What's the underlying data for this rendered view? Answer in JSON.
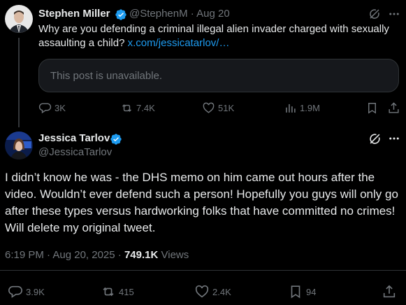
{
  "tweet1": {
    "name": "Stephen Miller",
    "handle": "@StephenM",
    "dot": "·",
    "date": "Aug 20",
    "text": "Why are you defending a criminal illegal alien invader charged with sexually assaulting a child?",
    "link": "x.com/jessicatarlov/…",
    "quote_unavailable": "This post is unavailable.",
    "actions": {
      "replies": "3K",
      "reposts": "7.4K",
      "likes": "51K",
      "views": "1.9M"
    }
  },
  "tweet2": {
    "name": "Jessica Tarlov",
    "handle": "@JessicaTarlov",
    "text": "I didn’t know he was - the DHS memo on him came out hours after the video. Wouldn’t ever defend such a person! Hopefully you guys will only go after these types versus hardworking folks that have committed no crimes! Will delete my original tweet.",
    "time": "6:19 PM · Aug 20, 2025 ·",
    "views_count": "749.1K",
    "views_label": "Views",
    "actions": {
      "replies": "3.9K",
      "reposts": "415",
      "likes": "2.4K",
      "bookmarks": "94"
    }
  },
  "colors": {
    "background": "#000000",
    "text": "#e7e9ea",
    "muted": "#71767b",
    "link": "#1d9bf0",
    "verified": "#1d9bf0",
    "border": "#2f3336"
  },
  "icons": [
    "verified-badge-icon",
    "grok-icon",
    "more-icon",
    "reply-icon",
    "repost-icon",
    "like-icon",
    "views-icon",
    "bookmark-icon",
    "share-icon"
  ]
}
